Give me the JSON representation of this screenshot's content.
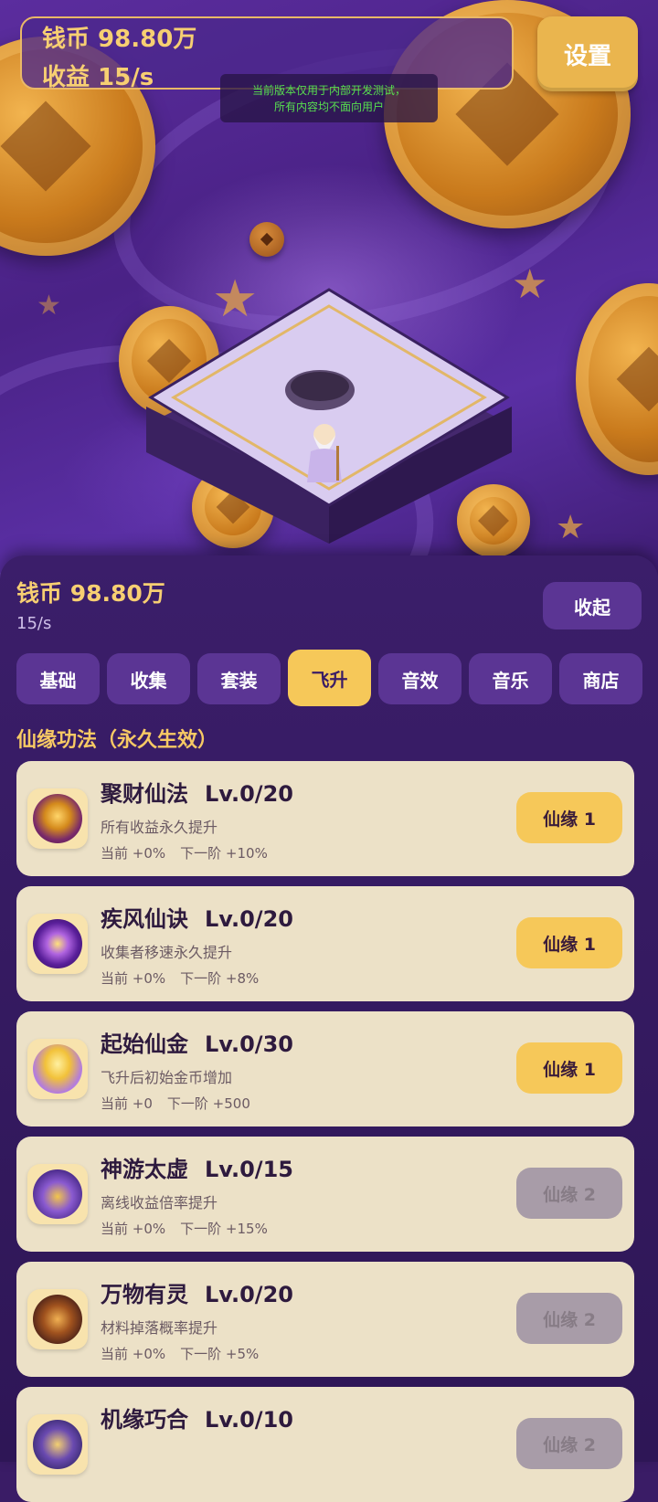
{
  "hud": {
    "coins_text": "钱币 98.80万",
    "income_text": "收益 15/s",
    "settings_label": "设置",
    "notice_line1": "当前版本仅用于内部开发测试，",
    "notice_line2": "所有内容均不面向用户"
  },
  "panel": {
    "coins_text": "钱币 98.80万",
    "rate_text": "15/s",
    "collapse_label": "收起",
    "tabs": [
      {
        "label": "基础",
        "active": false
      },
      {
        "label": "收集",
        "active": false
      },
      {
        "label": "套装",
        "active": false
      },
      {
        "label": "飞升",
        "active": true
      },
      {
        "label": "音效",
        "active": false
      },
      {
        "label": "音乐",
        "active": false
      },
      {
        "label": "商店",
        "active": false
      }
    ],
    "section_title": "仙缘功法（永久生效）",
    "cards": [
      {
        "name": "聚财仙法",
        "level": "Lv.0/20",
        "desc": "所有收益永久提升",
        "current": "当前 +0%",
        "next": "下一阶 +10%",
        "button": "仙缘 1",
        "enabled": true,
        "icon": "golden-idol-icon"
      },
      {
        "name": "疾风仙诀",
        "level": "Lv.0/20",
        "desc": "收集者移速永久提升",
        "current": "当前 +0%",
        "next": "下一阶 +8%",
        "button": "仙缘 1",
        "enabled": true,
        "icon": "purple-vortex-icon"
      },
      {
        "name": "起始仙金",
        "level": "Lv.0/30",
        "desc": "飞升后初始金币增加",
        "current": "当前 +0",
        "next": "下一阶 +500",
        "button": "仙缘 1",
        "enabled": true,
        "icon": "gold-ingot-icon"
      },
      {
        "name": "神游太虚",
        "level": "Lv.0/15",
        "desc": "离线收益倍率提升",
        "current": "当前 +0%",
        "next": "下一阶 +15%",
        "button": "仙缘 2",
        "enabled": false,
        "icon": "purple-dragon-icon"
      },
      {
        "name": "万物有灵",
        "level": "Lv.0/20",
        "desc": "材料掉落概率提升",
        "current": "当前 +0%",
        "next": "下一阶 +5%",
        "button": "仙缘 2",
        "enabled": false,
        "icon": "spirit-beast-icon"
      },
      {
        "name": "机缘巧合",
        "level": "Lv.0/10",
        "desc": "",
        "current": "",
        "next": "",
        "button": "仙缘 2",
        "enabled": false,
        "icon": "fortune-orb-icon"
      }
    ]
  },
  "colors": {
    "accent_gold": "#f6c859",
    "panel_purple": "#3b1e6a",
    "tab_purple": "#5b3594",
    "card_cream": "#ece1c7",
    "disabled_button": "#a89ca8",
    "notice_green": "#58e04f"
  }
}
